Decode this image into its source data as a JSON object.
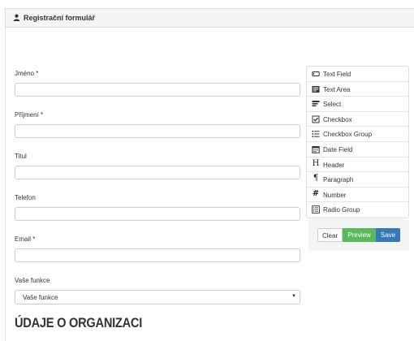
{
  "panel": {
    "title": "Registrační formulář"
  },
  "form": {
    "fields": [
      {
        "label": "Jméno *"
      },
      {
        "label": "Příjmení *"
      },
      {
        "label": "Titul"
      },
      {
        "label": "Telefon"
      },
      {
        "label": "Email *"
      }
    ],
    "function_select": {
      "label": "Vaše funkce",
      "value": "Vaše funkce"
    }
  },
  "section_heading": "ÚDAJE O ORGANIZACI",
  "toolbox": {
    "items": [
      {
        "label": "Text Field",
        "icon": "text-field-icon"
      },
      {
        "label": "Text Area",
        "icon": "text-area-icon"
      },
      {
        "label": "Select",
        "icon": "select-icon"
      },
      {
        "label": "Checkbox",
        "icon": "checkbox-icon"
      },
      {
        "label": "Checkbox Group",
        "icon": "checkbox-group-icon"
      },
      {
        "label": "Date Field",
        "icon": "calendar-icon"
      },
      {
        "label": "Header",
        "icon": "header-icon"
      },
      {
        "label": "Paragraph",
        "icon": "paragraph-icon"
      },
      {
        "label": "Number",
        "icon": "number-icon"
      },
      {
        "label": "Radio Group",
        "icon": "radio-group-icon"
      }
    ]
  },
  "actions": {
    "clear": "Clear",
    "preview": "Preview",
    "save": "Save"
  },
  "colors": {
    "preview": "#5cb85c",
    "save": "#337ab7"
  }
}
